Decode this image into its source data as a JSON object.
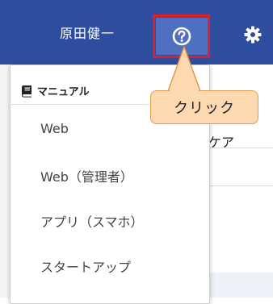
{
  "header": {
    "user_name": "原田健一",
    "help_icon": "question-circle-icon",
    "settings_icon": "gear-icon"
  },
  "background": {
    "column_header": "ケア"
  },
  "menu": {
    "header_icon": "book-icon",
    "header_label": "マニュアル",
    "items": [
      {
        "label": "Web"
      },
      {
        "label": "Web（管理者）"
      },
      {
        "label": "アプリ（スマホ）"
      },
      {
        "label": "スタートアップ"
      }
    ]
  },
  "callout": {
    "text": "クリック"
  },
  "colors": {
    "topbar": "#2e4d9e",
    "help_button": "#4f6fc0",
    "highlight_border": "#e41e25",
    "callout_fill": "#fcd9b1",
    "callout_border": "#e09b4a"
  }
}
